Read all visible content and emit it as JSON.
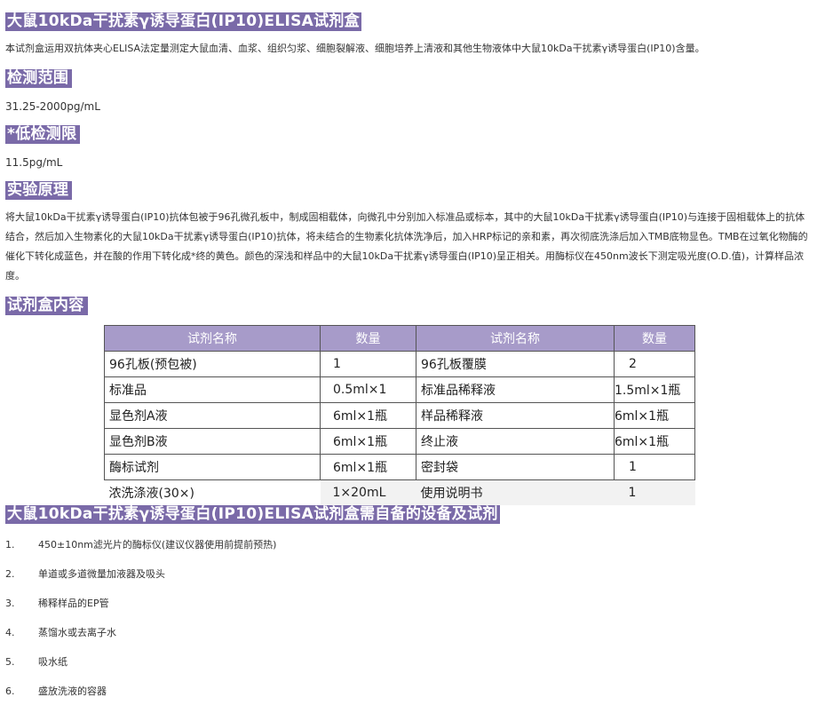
{
  "title": "大鼠10kDa干扰素γ诱导蛋白(IP10)ELISA试剂盒",
  "intro": "本试剂盒运用双抗体夹心ELISA法定量测定大鼠血清、血浆、组织匀浆、细胞裂解液、细胞培养上清液和其他生物液体中大鼠10kDa干扰素γ诱导蛋白(IP10)含量。",
  "range": {
    "heading": "检测范围",
    "value": "31.25-2000pg/mL"
  },
  "sensitivity": {
    "heading": "*低检测限",
    "value": "11.5pg/mL"
  },
  "principle": {
    "heading": "实验原理",
    "text": "将大鼠10kDa干扰素γ诱导蛋白(IP10)抗体包被于96孔微孔板中，制成固相载体，向微孔中分别加入标准品或标本，其中的大鼠10kDa干扰素γ诱导蛋白(IP10)与连接于固相载体上的抗体结合，然后加入生物素化的大鼠10kDa干扰素γ诱导蛋白(IP10)抗体，将未结合的生物素化抗体洗净后，加入HRP标记的亲和素，再次彻底洗涤后加入TMB底物显色。TMB在过氧化物酶的催化下转化成蓝色，并在酸的作用下转化成*终的黄色。颜色的深浅和样品中的大鼠10kDa干扰素γ诱导蛋白(IP10)呈正相关。用酶标仪在450nm波长下测定吸光度(O.D.值)，计算样品浓度。"
  },
  "contents": {
    "heading": "试剂盒内容",
    "headers": [
      "试剂名称",
      "数量",
      "试剂名称",
      "数量"
    ],
    "rows": [
      [
        "96孔板(预包被)",
        "1",
        "96孔板覆膜",
        "2"
      ],
      [
        "标准品",
        "0.5ml×1",
        "标准品稀释液",
        "1.5ml×1瓶"
      ],
      [
        "显色剂A液",
        "6ml×1瓶",
        "样品稀释液",
        "6ml×1瓶"
      ],
      [
        "显色剂B液",
        "6ml×1瓶",
        "终止液",
        "6ml×1瓶"
      ],
      [
        "酶标试剂",
        "6ml×1瓶",
        "密封袋",
        "1"
      ],
      [
        "浓洗涤液(30×)",
        "1×20mL",
        "使用说明书",
        "1"
      ]
    ]
  },
  "equipment": {
    "heading": "大鼠10kDa干扰素γ诱导蛋白(IP10)ELISA试剂盒需自备的设备及试剂",
    "items": [
      {
        "n": "1.",
        "text": "450±10nm滤光片的酶标仪(建议仪器使用前提前预热)"
      },
      {
        "n": "2.",
        "text": "单道或多道微量加液器及吸头"
      },
      {
        "n": "3.",
        "text": "稀释样品的EP管"
      },
      {
        "n": "4.",
        "text": "蒸馏水或去离子水"
      },
      {
        "n": "5.",
        "text": "吸水纸"
      },
      {
        "n": "6.",
        "text": "盛放洗液的容器"
      }
    ]
  },
  "colors": {
    "heading_bg": "#7a6aa8",
    "table_header_bg": "#a79bc9"
  }
}
